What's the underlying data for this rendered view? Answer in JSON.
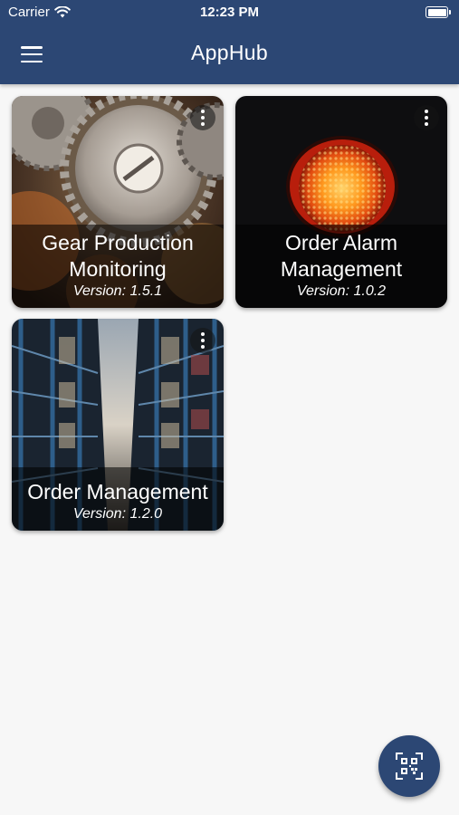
{
  "status_bar": {
    "carrier": "Carrier",
    "time": "12:23 PM",
    "battery_level": 1.0,
    "wifi_icon": "wifi-icon",
    "battery_icon": "battery-icon"
  },
  "app_bar": {
    "title": "AppHub",
    "menu_icon": "hamburger-menu-icon",
    "background_color": "#2c4774"
  },
  "apps": [
    {
      "name": "Gear Production Monitoring",
      "version": "Version: 1.5.1",
      "image": "gears"
    },
    {
      "name": "Order Alarm Management",
      "version": "Version: 1.0.2",
      "image": "warning-light"
    },
    {
      "name": "Order Management",
      "version": "Version: 1.2.0",
      "image": "warehouse-shelves"
    }
  ],
  "fab": {
    "icon": "qr-code-scan-icon",
    "color": "#2c4774"
  }
}
